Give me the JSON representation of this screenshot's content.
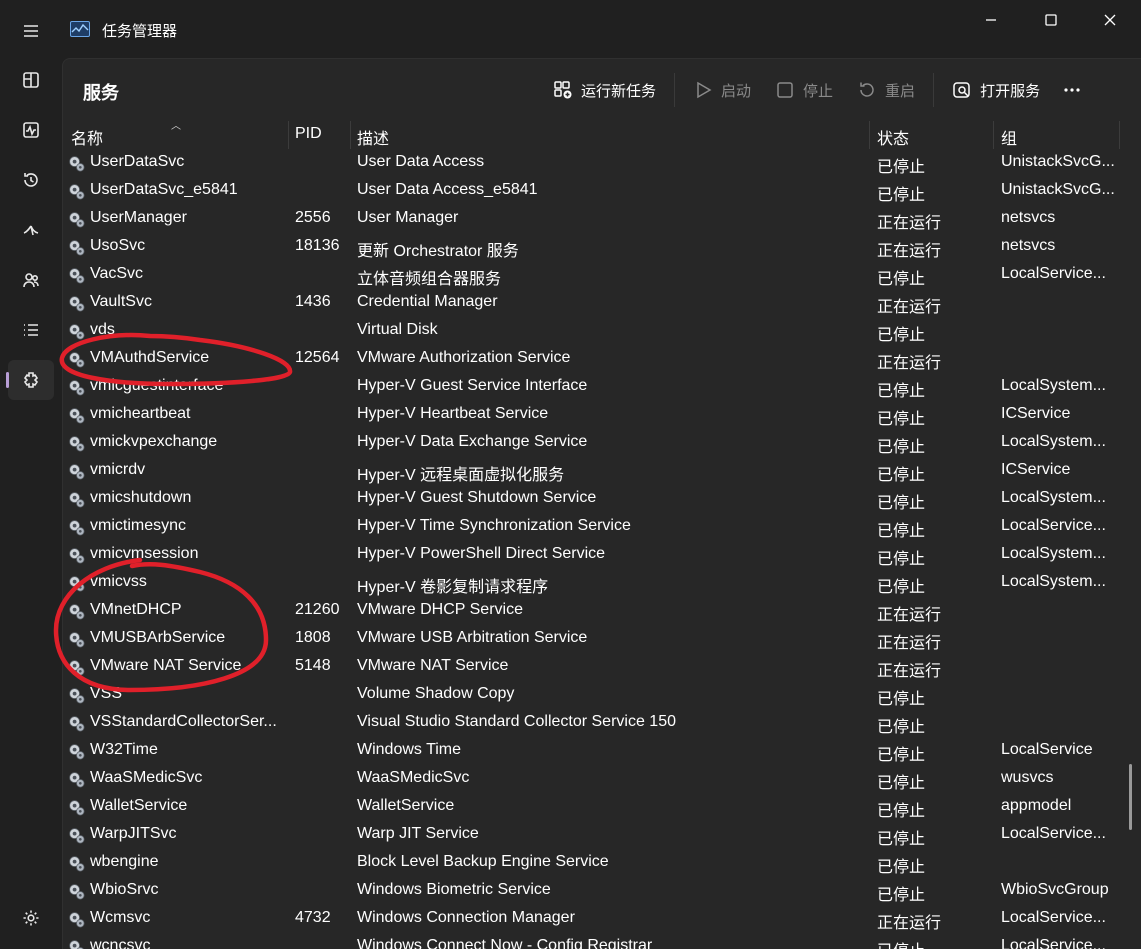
{
  "window": {
    "title": "任务管理器"
  },
  "nav": {
    "items": [
      {
        "icon": "hamburger-menu-icon"
      },
      {
        "icon": "processes-icon"
      },
      {
        "icon": "performance-icon"
      },
      {
        "icon": "app-history-icon"
      },
      {
        "icon": "startup-apps-icon"
      },
      {
        "icon": "users-icon"
      },
      {
        "icon": "details-icon"
      },
      {
        "icon": "services-icon",
        "active": true
      },
      {
        "icon": "settings-icon"
      }
    ]
  },
  "page": {
    "title": "服务"
  },
  "toolbar": {
    "run_new_task": "运行新任务",
    "start": "启动",
    "stop": "停止",
    "restart": "重启",
    "open_services": "打开服务"
  },
  "columns": {
    "name": "名称",
    "pid": "PID",
    "desc": "描述",
    "status": "状态",
    "group": "组"
  },
  "rows": [
    {
      "name": "UserDataSvc",
      "pid": "",
      "desc": "User Data Access",
      "status": "已停止",
      "group": "UnistackSvcG..."
    },
    {
      "name": "UserDataSvc_e5841",
      "pid": "",
      "desc": "User Data Access_e5841",
      "status": "已停止",
      "group": "UnistackSvcG..."
    },
    {
      "name": "UserManager",
      "pid": "2556",
      "desc": "User Manager",
      "status": "正在运行",
      "group": "netsvcs"
    },
    {
      "name": "UsoSvc",
      "pid": "18136",
      "desc": "更新 Orchestrator 服务",
      "status": "正在运行",
      "group": "netsvcs"
    },
    {
      "name": "VacSvc",
      "pid": "",
      "desc": "立体音频组合器服务",
      "status": "已停止",
      "group": "LocalService..."
    },
    {
      "name": "VaultSvc",
      "pid": "1436",
      "desc": "Credential Manager",
      "status": "正在运行",
      "group": ""
    },
    {
      "name": "vds",
      "pid": "",
      "desc": "Virtual Disk",
      "status": "已停止",
      "group": ""
    },
    {
      "name": "VMAuthdService",
      "pid": "12564",
      "desc": "VMware Authorization Service",
      "status": "正在运行",
      "group": ""
    },
    {
      "name": "vmicguestinterface",
      "pid": "",
      "desc": "Hyper-V Guest Service Interface",
      "status": "已停止",
      "group": "LocalSystem..."
    },
    {
      "name": "vmicheartbeat",
      "pid": "",
      "desc": "Hyper-V Heartbeat Service",
      "status": "已停止",
      "group": "ICService"
    },
    {
      "name": "vmickvpexchange",
      "pid": "",
      "desc": "Hyper-V Data Exchange Service",
      "status": "已停止",
      "group": "LocalSystem..."
    },
    {
      "name": "vmicrdv",
      "pid": "",
      "desc": "Hyper-V 远程桌面虚拟化服务",
      "status": "已停止",
      "group": "ICService"
    },
    {
      "name": "vmicshutdown",
      "pid": "",
      "desc": "Hyper-V Guest Shutdown Service",
      "status": "已停止",
      "group": "LocalSystem..."
    },
    {
      "name": "vmictimesync",
      "pid": "",
      "desc": "Hyper-V Time Synchronization Service",
      "status": "已停止",
      "group": "LocalService..."
    },
    {
      "name": "vmicvmsession",
      "pid": "",
      "desc": "Hyper-V PowerShell Direct Service",
      "status": "已停止",
      "group": "LocalSystem..."
    },
    {
      "name": "vmicvss",
      "pid": "",
      "desc": "Hyper-V 卷影复制请求程序",
      "status": "已停止",
      "group": "LocalSystem..."
    },
    {
      "name": "VMnetDHCP",
      "pid": "21260",
      "desc": "VMware DHCP Service",
      "status": "正在运行",
      "group": ""
    },
    {
      "name": "VMUSBArbService",
      "pid": "1808",
      "desc": "VMware USB Arbitration Service",
      "status": "正在运行",
      "group": ""
    },
    {
      "name": "VMware NAT Service",
      "pid": "5148",
      "desc": "VMware NAT Service",
      "status": "正在运行",
      "group": ""
    },
    {
      "name": "VSS",
      "pid": "",
      "desc": "Volume Shadow Copy",
      "status": "已停止",
      "group": ""
    },
    {
      "name": "VSStandardCollectorSer...",
      "pid": "",
      "desc": "Visual Studio Standard Collector Service 150",
      "status": "已停止",
      "group": ""
    },
    {
      "name": "W32Time",
      "pid": "",
      "desc": "Windows Time",
      "status": "已停止",
      "group": "LocalService"
    },
    {
      "name": "WaaSMedicSvc",
      "pid": "",
      "desc": "WaaSMedicSvc",
      "status": "已停止",
      "group": "wusvcs"
    },
    {
      "name": "WalletService",
      "pid": "",
      "desc": "WalletService",
      "status": "已停止",
      "group": "appmodel"
    },
    {
      "name": "WarpJITSvc",
      "pid": "",
      "desc": "Warp JIT Service",
      "status": "已停止",
      "group": "LocalService..."
    },
    {
      "name": "wbengine",
      "pid": "",
      "desc": "Block Level Backup Engine Service",
      "status": "已停止",
      "group": ""
    },
    {
      "name": "WbioSrvc",
      "pid": "",
      "desc": "Windows Biometric Service",
      "status": "已停止",
      "group": "WbioSvcGroup"
    },
    {
      "name": "Wcmsvc",
      "pid": "4732",
      "desc": "Windows Connection Manager",
      "status": "正在运行",
      "group": "LocalService..."
    },
    {
      "name": "wcncsvc",
      "pid": "",
      "desc": "Windows Connect Now - Config Registrar",
      "status": "已停止",
      "group": "LocalService..."
    }
  ],
  "colors": {
    "background": "#202020",
    "panel": "#272727",
    "accent": "#b89ed6",
    "annotation": "#e0202a"
  }
}
